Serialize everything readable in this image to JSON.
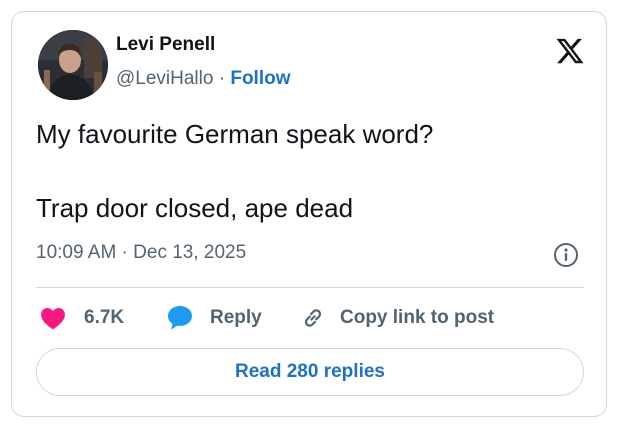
{
  "author": {
    "name": "Levi Penell",
    "handle": "@LeviHallo",
    "separator": "·",
    "follow_label": "Follow"
  },
  "tweet": {
    "lines": [
      "My favourite German speak word?",
      "Trap door closed, ape dead"
    ],
    "timestamp": "10:09 AM · Dec 13, 2025"
  },
  "actions": {
    "likes": "6.7K",
    "reply_label": "Reply",
    "copy_label": "Copy link to post"
  },
  "read_replies_label": "Read 280 replies",
  "icons": {
    "brand": "x-logo-icon",
    "info": "info-icon",
    "like": "heart-icon",
    "reply": "speech-bubble-icon",
    "copy": "link-icon"
  },
  "colors": {
    "heart": "#f91880",
    "reply_bubble": "#1d9bf0",
    "link_blue": "#1d72c8",
    "secondary_text": "#536471",
    "border": "#cfd9de"
  }
}
